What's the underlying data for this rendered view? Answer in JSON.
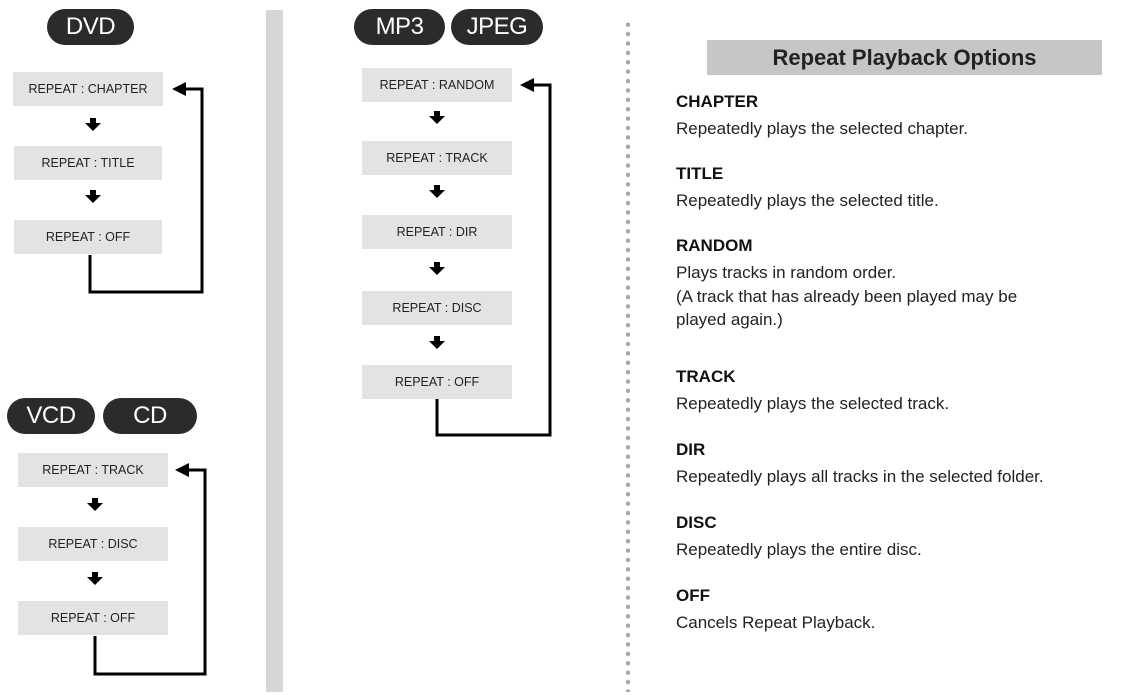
{
  "dvd": {
    "badge": "DVD",
    "steps": [
      "REPEAT : CHAPTER",
      "REPEAT : TITLE",
      "REPEAT : OFF"
    ]
  },
  "vcd_cd": {
    "badges": [
      "VCD",
      "CD"
    ],
    "steps": [
      "REPEAT : TRACK",
      "REPEAT : DISC",
      "REPEAT : OFF"
    ]
  },
  "mp3_jpeg": {
    "badges": [
      "MP3",
      "JPEG"
    ],
    "steps": [
      "REPEAT : RANDOM",
      "REPEAT : TRACK",
      "REPEAT : DIR",
      "REPEAT : DISC",
      "REPEAT : OFF"
    ]
  },
  "options": {
    "header": "Repeat Playback Options",
    "items": [
      {
        "title": "CHAPTER",
        "description": "Repeatedly plays the selected chapter."
      },
      {
        "title": "TITLE",
        "description": "Repeatedly plays the selected title."
      },
      {
        "title": "RANDOM",
        "description": "Plays tracks in random order.",
        "note_line1": "(A track that has already been played may be",
        "note_line2": "played again.)"
      },
      {
        "title": "TRACK",
        "description": "Repeatedly plays the selected track."
      },
      {
        "title": "DIR",
        "description": "Repeatedly plays all tracks in the selected folder."
      },
      {
        "title": "DISC",
        "description": "Repeatedly plays the entire disc."
      },
      {
        "title": "OFF",
        "description": "Cancels Repeat Playback."
      }
    ]
  },
  "colors": {
    "badge": "#2b2b2b",
    "step_box": "#e3e3e3",
    "header_bar": "#c6c6c6",
    "divider": "#d6d6d6"
  }
}
